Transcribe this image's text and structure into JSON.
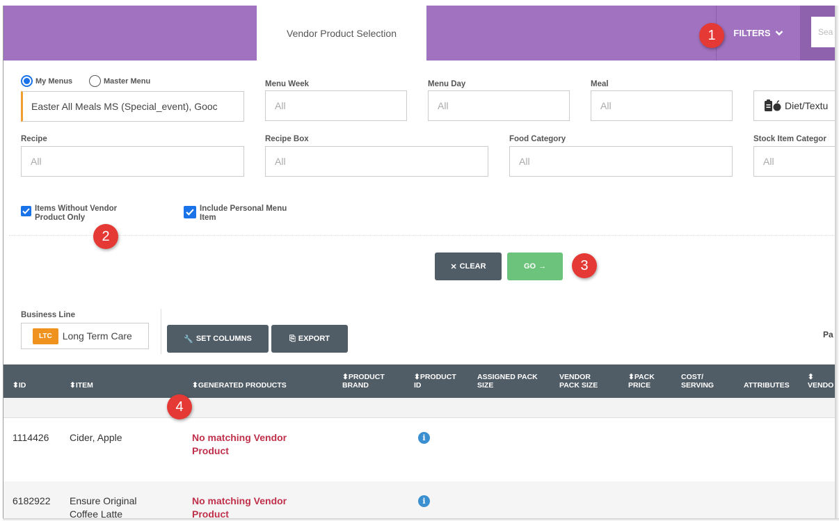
{
  "header": {
    "active_tab": "Vendor Product Selection",
    "filters_label": "FILTERS",
    "search_placeholder": "Sea"
  },
  "filters": {
    "radio_my_menus": "My Menus",
    "radio_master_menu": "Master Menu",
    "selected_radio": "My Menus",
    "menu_value": "Easter All Meals MS (Special_event), Gooc",
    "menu_week_label": "Menu Week",
    "menu_week_value": "All",
    "menu_day_label": "Menu Day",
    "menu_day_value": "All",
    "meal_label": "Meal",
    "meal_value": "All",
    "diet_button": "Diet/Textu",
    "recipe_label": "Recipe",
    "recipe_value": "All",
    "recipe_box_label": "Recipe Box",
    "recipe_box_value": "All",
    "food_category_label": "Food Category",
    "food_category_value": "All",
    "stock_item_label": "Stock Item Categor",
    "stock_item_value": "All",
    "items_without_vendor_line1": "Items Without Vendor",
    "items_without_vendor_line2": "Product Only",
    "include_personal_line1": "Include Personal Menu",
    "include_personal_line2": "Item"
  },
  "actions": {
    "clear": "CLEAR",
    "go": "GO"
  },
  "business_line": {
    "label": "Business Line",
    "badge": "LTC",
    "value": "Long Term Care"
  },
  "toolbar": {
    "set_columns": "SET COLUMNS",
    "export": "EXPORT",
    "pagination_partial": "Pa"
  },
  "annotations": [
    "1",
    "2",
    "3",
    "4"
  ],
  "table": {
    "columns": {
      "id": "ID",
      "item": "ITEM",
      "generated_products": "GENERATED PRODUCTS",
      "product_brand_1": "PRODUCT",
      "product_brand_2": "BRAND",
      "product_id_1": "PRODUCT",
      "product_id_2": "ID",
      "assigned_pack_1": "ASSIGNED PACK",
      "assigned_pack_2": "SIZE",
      "vendor_pack_1": "VENDOR",
      "vendor_pack_2": "PACK SIZE",
      "pack_price_1": "PACK",
      "pack_price_2": "PRICE",
      "cost_serving_1": "COST/",
      "cost_serving_2": "SERVING",
      "attributes": "ATTRIBUTES",
      "vendor": "VENDO"
    },
    "rows": [
      {
        "id": "1114426",
        "item_1": "Cider, Apple",
        "item_2": "",
        "gen_1": "No matching Vendor",
        "gen_2": "Product"
      },
      {
        "id": "6182922",
        "item_1": "Ensure Original",
        "item_2": "Coffee Latte",
        "gen_1": "No matching Vendor",
        "gen_2": "Product"
      }
    ]
  },
  "colors": {
    "header_purple": "#a172bf",
    "table_header": "#505c66",
    "go_green": "#6cc47c",
    "ltc_orange": "#f0931e",
    "no_match_red": "#c0304a",
    "badge_red": "#e53935"
  }
}
